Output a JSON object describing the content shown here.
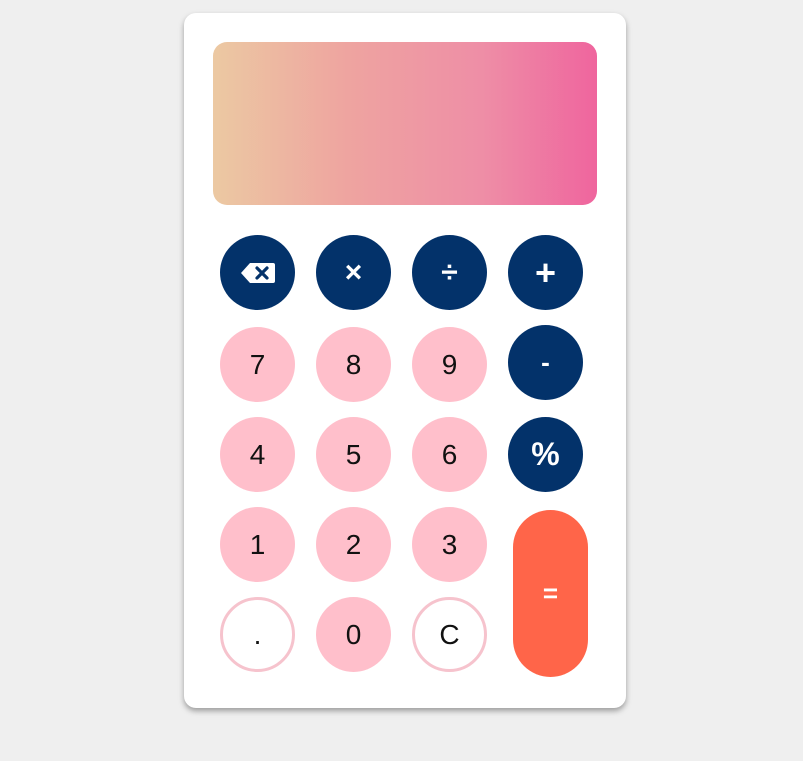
{
  "display": {
    "value": ""
  },
  "buttons": {
    "backspace_icon": "backspace-icon",
    "multiply": "×",
    "divide": "÷",
    "add": "+",
    "seven": "7",
    "eight": "8",
    "nine": "9",
    "subtract": "-",
    "four": "4",
    "five": "5",
    "six": "6",
    "percent": "%",
    "one": "1",
    "two": "2",
    "three": "3",
    "decimal": ".",
    "zero": "0",
    "clear": "C",
    "equals": "="
  },
  "colors": {
    "page_background": "#efefef",
    "card_background": "#ffffff",
    "number_button": "#ffbfcb",
    "operator_button": "#03326a",
    "equals_button": "#ff6549",
    "display_gradient_start": "#ecc9a2",
    "display_gradient_end": "#ef659e"
  }
}
